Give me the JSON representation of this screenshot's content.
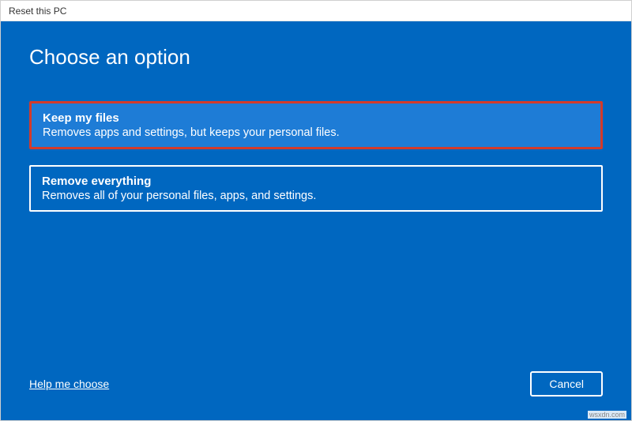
{
  "window": {
    "title": "Reset this PC"
  },
  "heading": "Choose an option",
  "options": [
    {
      "title": "Keep my files",
      "description": "Removes apps and settings, but keeps your personal files."
    },
    {
      "title": "Remove everything",
      "description": "Removes all of your personal files, apps, and settings."
    }
  ],
  "footer": {
    "help_link": "Help me choose",
    "cancel_label": "Cancel"
  },
  "watermark": "wsxdn.com"
}
